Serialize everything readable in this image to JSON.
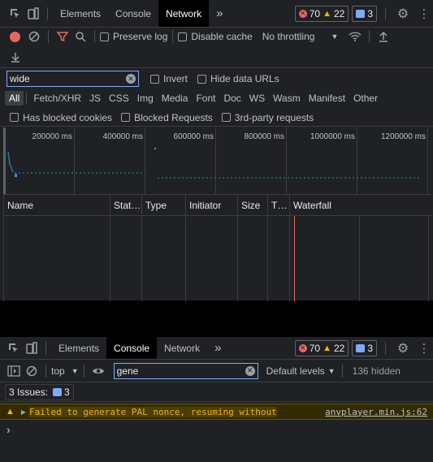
{
  "network_panel": {
    "tabs": [
      "Elements",
      "Console",
      "Network"
    ],
    "active_tab": "Network",
    "more_tabs_icon": "»",
    "errors_count": "70",
    "warnings_count": "22",
    "messages_count": "3",
    "toolbar": {
      "preserve_log": "Preserve log",
      "disable_cache": "Disable cache",
      "throttling": "No throttling"
    },
    "filter": {
      "value": "wide",
      "invert": "Invert",
      "hide_data_urls": "Hide data URLs"
    },
    "types": [
      "All",
      "Fetch/XHR",
      "JS",
      "CSS",
      "Img",
      "Media",
      "Font",
      "Doc",
      "WS",
      "Wasm",
      "Manifest",
      "Other"
    ],
    "active_type": "All",
    "options": {
      "blocked_cookies": "Has blocked cookies",
      "blocked_requests": "Blocked Requests",
      "third_party": "3rd-party requests"
    },
    "timeline_ticks": [
      "200000 ms",
      "400000 ms",
      "600000 ms",
      "800000 ms",
      "1000000 ms",
      "1200000 ms"
    ],
    "columns": [
      "Name",
      "Stat…",
      "Type",
      "Initiator",
      "Size",
      "T…",
      "Waterfall"
    ]
  },
  "drawer": {
    "tabs": [
      "Elements",
      "Console",
      "Network"
    ],
    "active_tab": "Console",
    "more_tabs_icon": "»",
    "errors_count": "70",
    "warnings_count": "22",
    "messages_count": "3",
    "context": "top",
    "filter_value": "gene",
    "levels": "Default levels",
    "hidden": "136 hidden",
    "issues_label": "3 Issues:",
    "issues_count": "3",
    "warning_message": "Failed to generate PAL nonce, resuming without",
    "warning_source": "anvplayer.min.js:62",
    "prompt": "›"
  },
  "colors": {
    "panel_bg": "#202124",
    "accent_blue": "#7cacf8",
    "error_red": "#e46962",
    "warning_yellow": "#f2b600",
    "warning_bg": "#332b00"
  }
}
